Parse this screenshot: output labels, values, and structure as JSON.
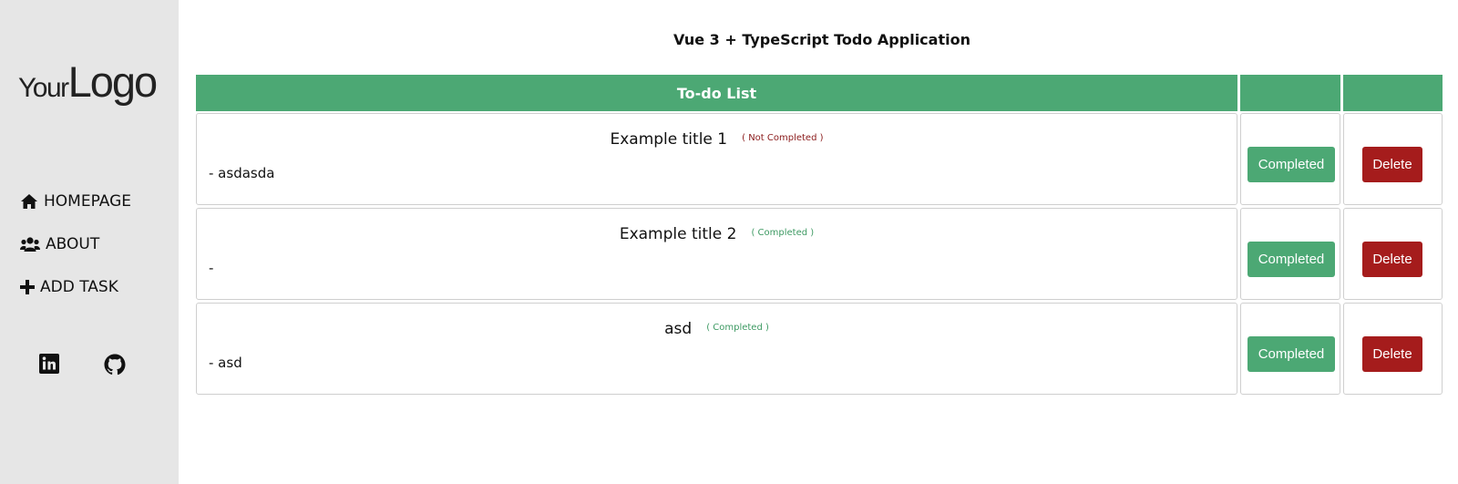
{
  "sidebar": {
    "logo": {
      "part1": "Your",
      "part2": "Logo"
    },
    "nav": [
      {
        "label": "HOMEPAGE",
        "icon": "home-icon"
      },
      {
        "label": "ABOUT",
        "icon": "users-icon"
      },
      {
        "label": "ADD TASK",
        "icon": "plus-icon"
      }
    ],
    "social": [
      {
        "icon": "linkedin-icon"
      },
      {
        "icon": "github-icon"
      }
    ]
  },
  "main": {
    "title": "Vue 3 + TypeScript Todo Application",
    "table_header": {
      "list": "To-do List",
      "col2": "",
      "col3": ""
    },
    "tasks": [
      {
        "title": "Example title 1",
        "status": "( Not Completed )",
        "description": "- asdasda",
        "complete_label": "Completed",
        "delete_label": "Delete"
      },
      {
        "title": "Example title 2",
        "status": "( Completed )",
        "description": "-",
        "complete_label": "Completed",
        "delete_label": "Delete"
      },
      {
        "title": "asd",
        "status": "( Completed )",
        "description": "- asd",
        "complete_label": "Completed",
        "delete_label": "Delete"
      }
    ]
  },
  "colors": {
    "sidebar_bg": "#e6e6e6",
    "accent_green": "#4ca874",
    "delete_red": "#a51c1c",
    "status_not_completed": "#8a1a1a",
    "status_completed": "#3e9a63"
  }
}
